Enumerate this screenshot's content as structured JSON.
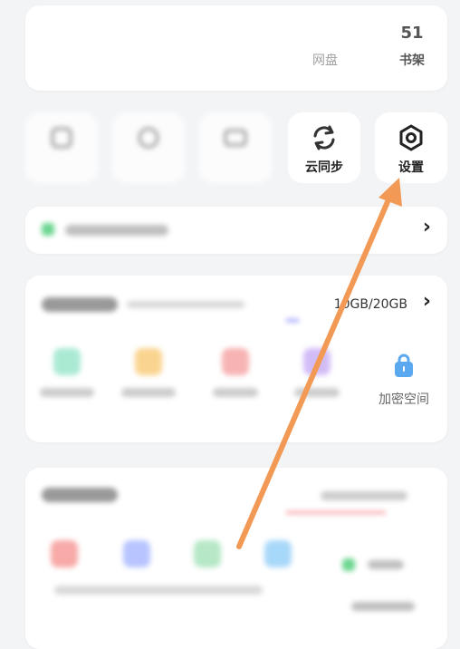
{
  "stats": [
    {
      "num": "",
      "label": ""
    },
    {
      "num": "",
      "label": ""
    },
    {
      "num": "",
      "label": ""
    },
    {
      "num": "",
      "label": "网盘"
    },
    {
      "num": "51",
      "label": "书架"
    }
  ],
  "tools": [
    {
      "label": "",
      "icon": "blurred-icon"
    },
    {
      "label": "",
      "icon": "blurred-icon"
    },
    {
      "label": "",
      "icon": "blurred-icon"
    },
    {
      "label": "云同步",
      "icon": "sync-icon"
    },
    {
      "label": "设置",
      "icon": "gear-icon"
    }
  ],
  "notice": {
    "chevron": "›"
  },
  "storage": {
    "usage": "10GB/20GB",
    "chevron": "›",
    "private_space": "加密空间"
  },
  "colors": {
    "arrow": "#f29a55",
    "private_icon": "#5aa9f0",
    "notice_dot": "#3cc86c"
  }
}
